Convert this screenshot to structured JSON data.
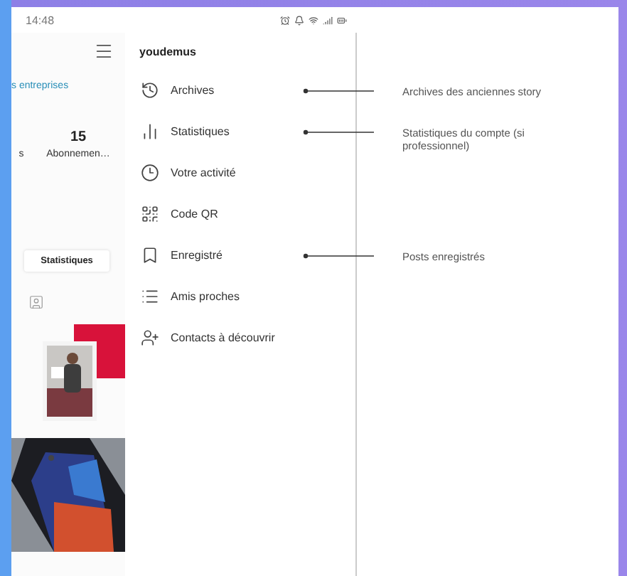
{
  "status_bar": {
    "time": "14:48"
  },
  "profile": {
    "link": "s entreprises",
    "stats": [
      {
        "label": "s"
      },
      {
        "value": "15",
        "label": "Abonnemen…"
      }
    ],
    "tab": {
      "label": "Statistiques",
      "selected": true
    }
  },
  "drawer": {
    "username": "youdemus",
    "items": [
      {
        "kind": "history",
        "label": "Archives",
        "note": "Archives des anciennes story"
      },
      {
        "kind": "chart",
        "label": "Statistiques",
        "note": "Statistiques du compte (si professionnel)"
      },
      {
        "kind": "activity",
        "label": "Votre activité"
      },
      {
        "kind": "qr",
        "label": "Code QR"
      },
      {
        "kind": "bookmark",
        "label": "Enregistré",
        "note": "Posts enregistrés"
      },
      {
        "kind": "list",
        "label": "Amis proches"
      },
      {
        "kind": "add-person",
        "label": "Contacts à découvrir"
      }
    ]
  }
}
